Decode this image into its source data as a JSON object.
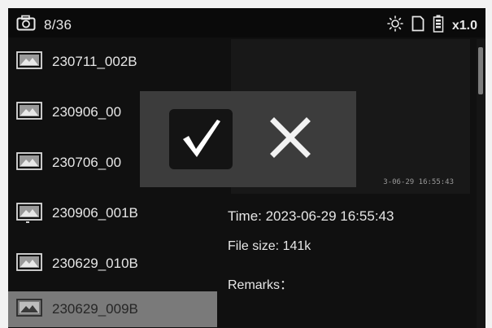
{
  "status": {
    "file_counter": "8/36",
    "zoom": "x1.0",
    "icons": [
      "camera-icon",
      "brightness-icon",
      "sd-card-icon",
      "battery-icon"
    ]
  },
  "files": [
    {
      "name": "230711_002B",
      "selected": false
    },
    {
      "name": "230906_00",
      "selected": false
    },
    {
      "name": "230706_00",
      "selected": false
    },
    {
      "name": "230906_001B",
      "selected": false
    },
    {
      "name": "230629_010B",
      "selected": false
    },
    {
      "name": "230629_009B",
      "selected": true
    }
  ],
  "preview": {
    "timestamp_overlay": "3-06-29 16:55:43"
  },
  "info": {
    "time": "Time: 2023-06-29  16:55:43",
    "size": "File size: 141k",
    "remarks": "Remarks："
  },
  "dialog": {
    "confirm_symbol": "√",
    "cancel_symbol": "✕",
    "icons": [
      "check-icon",
      "close-icon"
    ]
  },
  "colors": {
    "background": "#101010",
    "dialog": "#3c3c3c",
    "selected_row": "#7a7a7a"
  }
}
